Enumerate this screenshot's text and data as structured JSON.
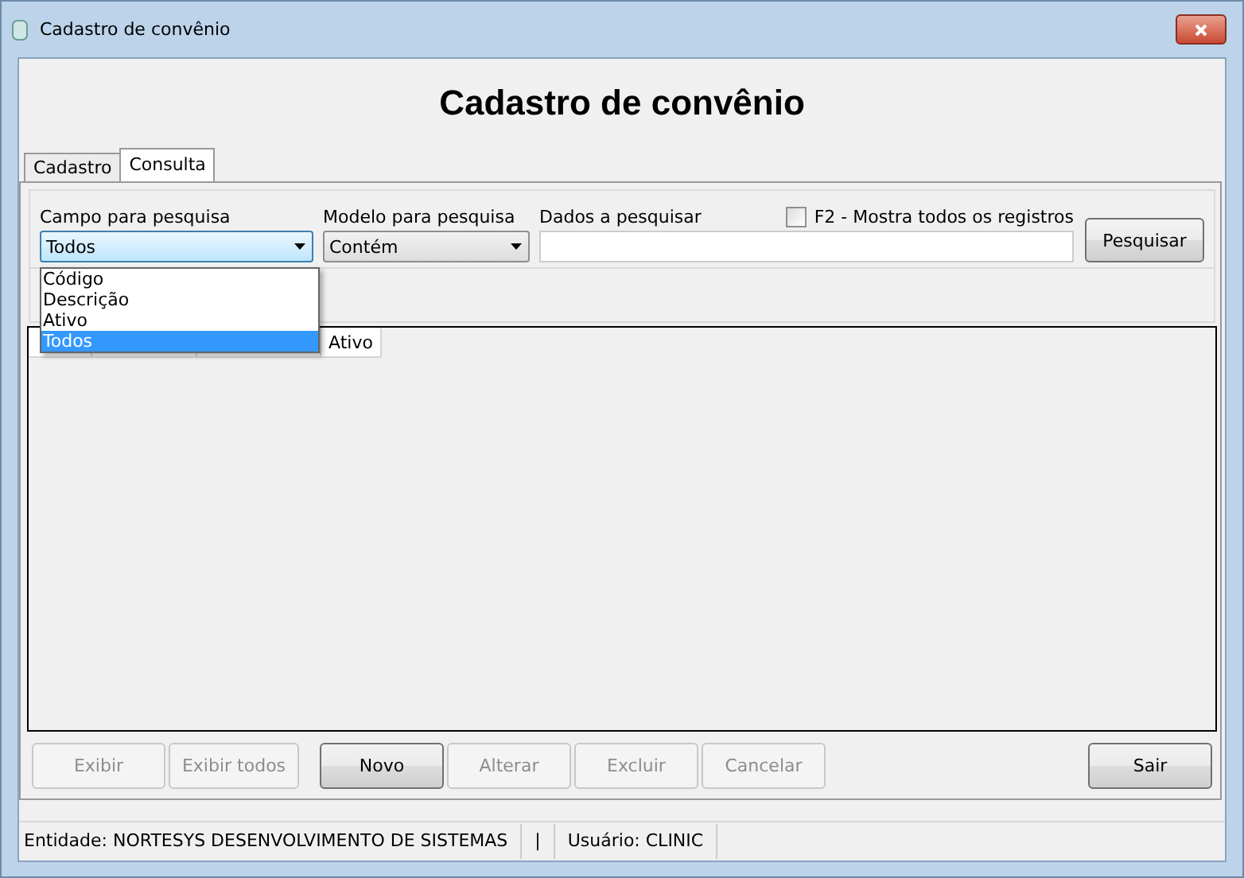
{
  "window": {
    "title": "Cadastro de convênio"
  },
  "heading": "Cadastro de convênio",
  "tabs": [
    {
      "label": "Cadastro",
      "selected": false
    },
    {
      "label": "Consulta",
      "selected": true
    }
  ],
  "search": {
    "field_label": "Campo para pesquisa",
    "field_value": "Todos",
    "field_options": [
      {
        "label": "Código",
        "selected": false
      },
      {
        "label": "Descrição",
        "selected": false
      },
      {
        "label": "Ativo",
        "selected": false
      },
      {
        "label": "Todos",
        "selected": true
      }
    ],
    "model_label": "Modelo para pesquisa",
    "model_value": "Contém",
    "data_label": "Dados a pesquisar",
    "show_all": {
      "label": "F2 - Mostra todos os registros",
      "checked": false
    },
    "button": "Pesquisar"
  },
  "table": {
    "columns": [
      "Ativo"
    ]
  },
  "button_groups": [
    [
      {
        "label": "Exibir",
        "disabled": true
      },
      {
        "label": "Exibir todos",
        "disabled": true
      }
    ],
    [
      {
        "label": "Novo",
        "disabled": false
      },
      {
        "label": "Alterar",
        "disabled": true
      },
      {
        "label": "Excluir",
        "disabled": true
      },
      {
        "label": "Cancelar",
        "disabled": true
      }
    ],
    [
      {
        "label": "Sair",
        "disabled": false
      }
    ]
  ],
  "status_bar": [
    "Entidade: NORTESYS DESENVOLVIMENTO DE SISTEMAS",
    "|",
    "Usuário: CLINIC"
  ]
}
